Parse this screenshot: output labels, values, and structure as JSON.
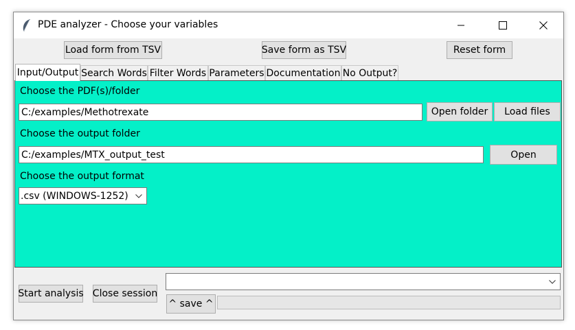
{
  "window": {
    "title": "PDE analyzer - Choose your variables",
    "minimize_icon": "minimize-icon",
    "maximize_icon": "maximize-icon",
    "close_icon": "close-icon",
    "app_icon": "feather-icon"
  },
  "toolbar": {
    "load_label": "Load form from TSV",
    "save_label": "Save form as TSV",
    "reset_label": "Reset form"
  },
  "tabs": [
    {
      "label": "Input/Output",
      "active": true
    },
    {
      "label": "Search Words",
      "active": false
    },
    {
      "label": "Filter Words",
      "active": false
    },
    {
      "label": "Parameters",
      "active": false
    },
    {
      "label": "Documentation",
      "active": false
    },
    {
      "label": "No Output?",
      "active": false
    }
  ],
  "io": {
    "pdf_label": "Choose the PDF(s)/folder",
    "pdf_value": "C:/examples/Methotrexate",
    "open_folder_label": "Open folder",
    "load_files_label": "Load files",
    "output_label": "Choose the output folder",
    "output_value": "C:/examples/MTX_output_test",
    "open_label": "Open",
    "format_label": "Choose the output format",
    "format_value": ".csv (WINDOWS-1252)",
    "panel_color": "#04f0c8"
  },
  "footer": {
    "start_label": "Start analysis",
    "close_label": "Close session",
    "combo_value": "",
    "save_label": "^ save ^",
    "progress": 0
  }
}
